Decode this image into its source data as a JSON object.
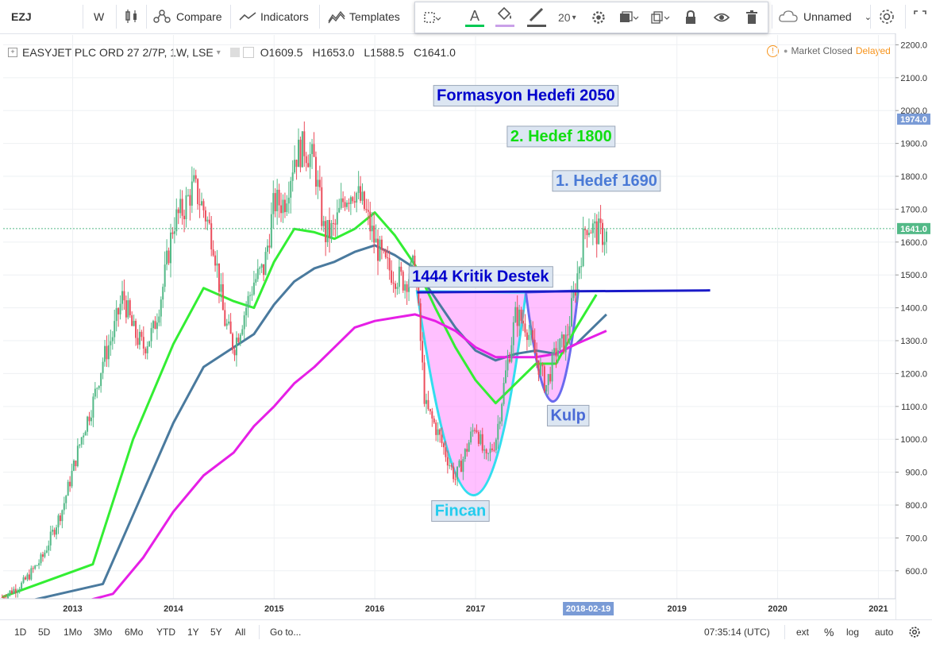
{
  "toolbar": {
    "symbol": "EZJ",
    "interval": "W",
    "compare": "Compare",
    "indicators": "Indicators",
    "templates": "Templates",
    "font_size": "20",
    "layout_name": "Unnamed",
    "accent_green": "#00c853"
  },
  "legend": {
    "title": "EASYJET PLC ORD 27 2/7P, 1W, LSE",
    "open": "O1609.5",
    "high": "H1653.0",
    "low": "L1588.5",
    "close": "C1641.0"
  },
  "status": {
    "market": "Market Closed",
    "delayed": "Delayed"
  },
  "bottom": {
    "ranges": [
      "1D",
      "5D",
      "1Mo",
      "3Mo",
      "6Mo",
      "YTD",
      "1Y",
      "5Y",
      "All"
    ],
    "goto": "Go to...",
    "time": "07:35:14 (UTC)",
    "ext": "ext",
    "percent": "%",
    "log": "log",
    "auto": "auto"
  },
  "chart_data": {
    "type": "line",
    "title": "",
    "xlabel": "",
    "ylabel": "",
    "x_ticks": [
      "2013",
      "2014",
      "2015",
      "2016",
      "2017",
      "2018-02-19",
      "2019",
      "2020",
      "2021"
    ],
    "y_ticks": [
      600,
      700,
      800,
      900,
      1000,
      1100,
      1200,
      1300,
      1400,
      1500,
      1600,
      1700,
      1800,
      1900,
      2000,
      2100,
      2200
    ],
    "ylim": [
      515,
      2230
    ],
    "xlim": [
      2012.31,
      2021.17
    ],
    "price_label": "1641.0",
    "price_value": 1641.0,
    "marker_label": "1974.0",
    "marker_value": 1974.0,
    "cursor_date_label": "2018-02-19",
    "cursor_date_x": 2018.12,
    "grid": true,
    "price_points": [
      [
        2012.3,
        520
      ],
      [
        2012.5,
        560
      ],
      [
        2012.7,
        640
      ],
      [
        2012.9,
        790
      ],
      [
        2013.1,
        1020
      ],
      [
        2013.2,
        1110
      ],
      [
        2013.3,
        1240
      ],
      [
        2013.4,
        1320
      ],
      [
        2013.5,
        1440
      ],
      [
        2013.6,
        1330
      ],
      [
        2013.7,
        1280
      ],
      [
        2013.8,
        1330
      ],
      [
        2013.9,
        1470
      ],
      [
        2014.0,
        1660
      ],
      [
        2014.1,
        1700
      ],
      [
        2014.2,
        1770
      ],
      [
        2014.3,
        1700
      ],
      [
        2014.4,
        1600
      ],
      [
        2014.5,
        1370
      ],
      [
        2014.6,
        1280
      ],
      [
        2014.7,
        1380
      ],
      [
        2014.8,
        1480
      ],
      [
        2014.9,
        1520
      ],
      [
        2015.0,
        1720
      ],
      [
        2015.1,
        1720
      ],
      [
        2015.2,
        1860
      ],
      [
        2015.3,
        1890
      ],
      [
        2015.4,
        1840
      ],
      [
        2015.5,
        1620
      ],
      [
        2015.6,
        1640
      ],
      [
        2015.7,
        1740
      ],
      [
        2015.8,
        1760
      ],
      [
        2015.9,
        1700
      ],
      [
        2016.0,
        1600
      ],
      [
        2016.1,
        1530
      ],
      [
        2016.2,
        1500
      ],
      [
        2016.3,
        1480
      ],
      [
        2016.4,
        1530
      ],
      [
        2016.5,
        1100
      ],
      [
        2016.6,
        1040
      ],
      [
        2016.7,
        960
      ],
      [
        2016.8,
        880
      ],
      [
        2016.9,
        960
      ],
      [
        2017.0,
        1050
      ],
      [
        2017.1,
        930
      ],
      [
        2017.2,
        1000
      ],
      [
        2017.3,
        1200
      ],
      [
        2017.4,
        1380
      ],
      [
        2017.5,
        1350
      ],
      [
        2017.6,
        1250
      ],
      [
        2017.7,
        1160
      ],
      [
        2017.8,
        1270
      ],
      [
        2017.9,
        1300
      ],
      [
        2018.0,
        1480
      ],
      [
        2018.1,
        1660
      ],
      [
        2018.2,
        1630
      ],
      [
        2018.3,
        1620
      ]
    ],
    "series": [
      {
        "color": "#33ee33",
        "points": [
          [
            2012.3,
            520
          ],
          [
            2013.2,
            620
          ],
          [
            2013.6,
            1000
          ],
          [
            2014.0,
            1290
          ],
          [
            2014.3,
            1460
          ],
          [
            2014.6,
            1420
          ],
          [
            2014.8,
            1400
          ],
          [
            2015.0,
            1540
          ],
          [
            2015.2,
            1640
          ],
          [
            2015.4,
            1630
          ],
          [
            2015.6,
            1610
          ],
          [
            2015.8,
            1640
          ],
          [
            2016.0,
            1690
          ],
          [
            2016.2,
            1620
          ],
          [
            2016.4,
            1530
          ],
          [
            2016.6,
            1400
          ],
          [
            2016.8,
            1280
          ],
          [
            2017.0,
            1180
          ],
          [
            2017.2,
            1110
          ],
          [
            2017.4,
            1170
          ],
          [
            2017.6,
            1230
          ],
          [
            2017.8,
            1230
          ],
          [
            2018.0,
            1340
          ],
          [
            2018.2,
            1440
          ]
        ]
      },
      {
        "color": "#4a7a9e",
        "points": [
          [
            2012.3,
            490
          ],
          [
            2013.3,
            560
          ],
          [
            2013.6,
            770
          ],
          [
            2014.0,
            1050
          ],
          [
            2014.3,
            1220
          ],
          [
            2014.6,
            1280
          ],
          [
            2014.8,
            1320
          ],
          [
            2015.0,
            1410
          ],
          [
            2015.2,
            1480
          ],
          [
            2015.4,
            1520
          ],
          [
            2015.6,
            1540
          ],
          [
            2015.8,
            1570
          ],
          [
            2016.0,
            1590
          ],
          [
            2016.2,
            1560
          ],
          [
            2016.4,
            1520
          ],
          [
            2016.6,
            1430
          ],
          [
            2016.8,
            1340
          ],
          [
            2017.0,
            1270
          ],
          [
            2017.2,
            1240
          ],
          [
            2017.4,
            1260
          ],
          [
            2017.6,
            1270
          ],
          [
            2017.8,
            1260
          ],
          [
            2018.0,
            1290
          ],
          [
            2018.3,
            1380
          ]
        ]
      },
      {
        "color": "#e61fe6",
        "points": [
          [
            2012.3,
            440
          ],
          [
            2013.4,
            530
          ],
          [
            2013.7,
            640
          ],
          [
            2014.0,
            780
          ],
          [
            2014.3,
            890
          ],
          [
            2014.6,
            960
          ],
          [
            2014.8,
            1040
          ],
          [
            2015.0,
            1100
          ],
          [
            2015.2,
            1170
          ],
          [
            2015.4,
            1220
          ],
          [
            2015.6,
            1280
          ],
          [
            2015.8,
            1340
          ],
          [
            2016.0,
            1360
          ],
          [
            2016.2,
            1370
          ],
          [
            2016.4,
            1380
          ],
          [
            2016.6,
            1360
          ],
          [
            2016.8,
            1330
          ],
          [
            2017.0,
            1280
          ],
          [
            2017.2,
            1250
          ],
          [
            2017.4,
            1250
          ],
          [
            2017.6,
            1250
          ],
          [
            2017.8,
            1260
          ],
          [
            2018.0,
            1290
          ],
          [
            2018.3,
            1330
          ]
        ]
      }
    ],
    "support_line": {
      "x": [
        2016.42,
        2019.33
      ],
      "y": [
        1447,
        1453
      ],
      "color": "#1a1ac8"
    },
    "cup": {
      "start": [
        2016.42,
        1450
      ],
      "bottom": [
        2017.0,
        830
      ],
      "end": [
        2017.5,
        1447
      ],
      "fill": "#ff8cff",
      "stroke": "#33ddee"
    },
    "handle": {
      "start": [
        2017.5,
        1447
      ],
      "bottom": [
        2017.78,
        1115
      ],
      "end": [
        2018.02,
        1452
      ],
      "fill": "#ff8cff",
      "stroke": "#6a6aee"
    },
    "annotations": [
      {
        "text": "Formasyon Hedefi 2050",
        "color": "#0000cc",
        "x": 2017.5,
        "y": 2045
      },
      {
        "text": "2. Hedef 1800",
        "color": "#11dd11",
        "x": 2017.85,
        "y": 1921
      },
      {
        "text": "1. Hedef 1690",
        "color": "#4a7ad6",
        "x": 2018.3,
        "y": 1786
      },
      {
        "text": "1444 Kritik Destek",
        "color": "#0000cc",
        "x": 2017.05,
        "y": 1494
      },
      {
        "text": "Kulp",
        "color": "#4a6ad6",
        "x": 2017.92,
        "y": 1072
      },
      {
        "text": "Fincan",
        "color": "#22ccee",
        "x": 2016.85,
        "y": 782
      }
    ]
  }
}
